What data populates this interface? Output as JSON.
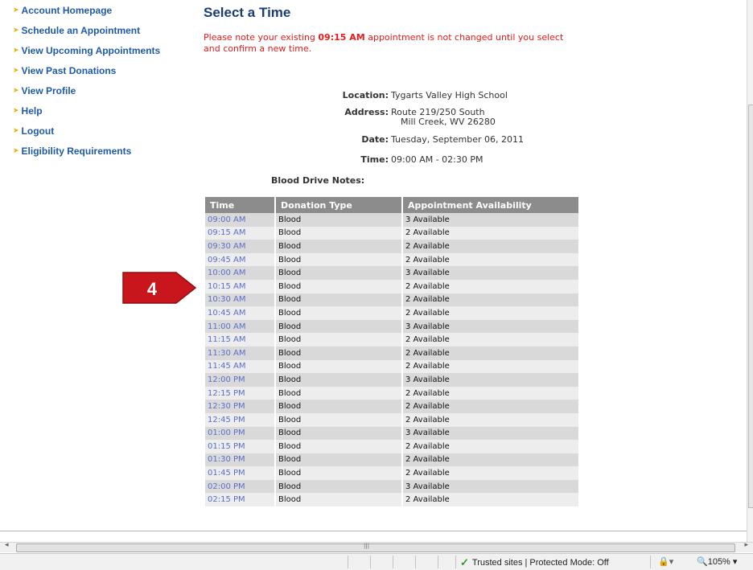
{
  "nav": {
    "items": [
      {
        "label": "Account Homepage"
      },
      {
        "label": "Schedule an Appointment"
      },
      {
        "label": "View Upcoming Appointments"
      },
      {
        "label": "View Past Donations"
      },
      {
        "label": "View Profile"
      },
      {
        "label": "Help"
      },
      {
        "label": "Logout"
      },
      {
        "label": "Eligibility Requirements"
      }
    ]
  },
  "page": {
    "title": "Select a Time",
    "notice_pre": "Please note your existing ",
    "notice_time": "09:15 AM",
    "notice_post": " appointment is not changed until you select and confirm a new time."
  },
  "info": {
    "location_label": "Location:",
    "location": "Tygarts Valley High School",
    "address_label": "Address:",
    "address_line1": "Route 219/250 South",
    "address_line2": "Mill Creek, WV 26280",
    "date_label": "Date:",
    "date": "Tuesday, September 06, 2011",
    "time_label": "Time:",
    "time": "09:00 AM - 02:30 PM",
    "notes_label": "Blood Drive Notes:"
  },
  "table": {
    "headers": [
      "Time",
      "Donation Type",
      "Appointment Availability"
    ],
    "rows": [
      {
        "time": "09:00 AM",
        "type": "Blood",
        "avail": "3 Available"
      },
      {
        "time": "09:15 AM",
        "type": "Blood",
        "avail": "2 Available"
      },
      {
        "time": "09:30 AM",
        "type": "Blood",
        "avail": "2 Available"
      },
      {
        "time": "09:45 AM",
        "type": "Blood",
        "avail": "2 Available"
      },
      {
        "time": "10:00 AM",
        "type": "Blood",
        "avail": "3 Available"
      },
      {
        "time": "10:15 AM",
        "type": "Blood",
        "avail": "2 Available"
      },
      {
        "time": "10:30 AM",
        "type": "Blood",
        "avail": "2 Available"
      },
      {
        "time": "10:45 AM",
        "type": "Blood",
        "avail": "2 Available"
      },
      {
        "time": "11:00 AM",
        "type": "Blood",
        "avail": "3 Available"
      },
      {
        "time": "11:15 AM",
        "type": "Blood",
        "avail": "2 Available"
      },
      {
        "time": "11:30 AM",
        "type": "Blood",
        "avail": "2 Available"
      },
      {
        "time": "11:45 AM",
        "type": "Blood",
        "avail": "2 Available"
      },
      {
        "time": "12:00 PM",
        "type": "Blood",
        "avail": "3 Available"
      },
      {
        "time": "12:15 PM",
        "type": "Blood",
        "avail": "2 Available"
      },
      {
        "time": "12:30 PM",
        "type": "Blood",
        "avail": "2 Available"
      },
      {
        "time": "12:45 PM",
        "type": "Blood",
        "avail": "2 Available"
      },
      {
        "time": "01:00 PM",
        "type": "Blood",
        "avail": "3 Available"
      },
      {
        "time": "01:15 PM",
        "type": "Blood",
        "avail": "2 Available"
      },
      {
        "time": "01:30 PM",
        "type": "Blood",
        "avail": "2 Available"
      },
      {
        "time": "01:45 PM",
        "type": "Blood",
        "avail": "2 Available"
      },
      {
        "time": "02:00 PM",
        "type": "Blood",
        "avail": "3 Available"
      },
      {
        "time": "02:15 PM",
        "type": "Blood",
        "avail": "2 Available"
      }
    ]
  },
  "callout": {
    "number": "4",
    "color": "#c8161c"
  },
  "status": {
    "zone": "Trusted sites | Protected Mode: Off",
    "zoom": "105%"
  },
  "colors": {
    "nav_link": "#1f5aa6",
    "title": "#1a3e73",
    "notice": "#e41c1c",
    "time_link": "#5b6fc8",
    "header_bg": "#8c8c8c"
  }
}
